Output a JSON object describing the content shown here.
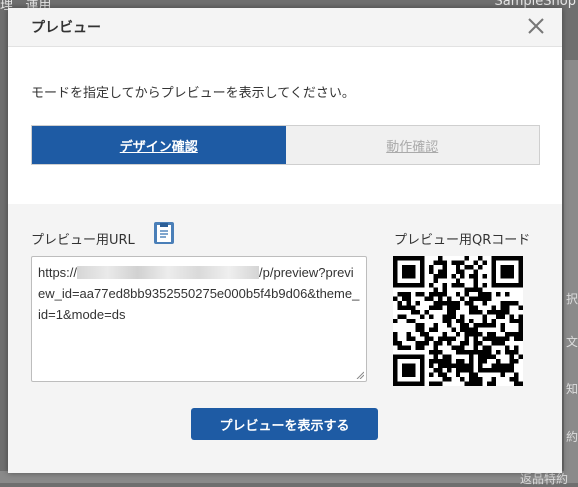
{
  "background": {
    "top_left_text": "理",
    "top_left_text2": "運用",
    "top_right_text": "SampleShop",
    "side_texts": [
      "択",
      "文",
      "知",
      "約"
    ],
    "bottom_text": "返品特約"
  },
  "modal": {
    "title": "プレビュー",
    "close_icon": "close-icon",
    "instruction": "モードを指定してからプレビューを表示してください。",
    "modes": [
      {
        "label": "デザイン確認",
        "active": true
      },
      {
        "label": "動作確認",
        "active": false
      }
    ],
    "url_label": "プレビュー用URL",
    "url_prefix": "https://",
    "url_suffix": "/p/preview?preview_id=aa77ed8bb9352550275e000b5f4b9d06&theme_id=1&mode=ds",
    "qr_label": "プレビュー用QRコード",
    "submit_label": "プレビューを表示する"
  },
  "colors": {
    "accent": "#1e5ba4",
    "overlay": "#6f6f6f"
  }
}
